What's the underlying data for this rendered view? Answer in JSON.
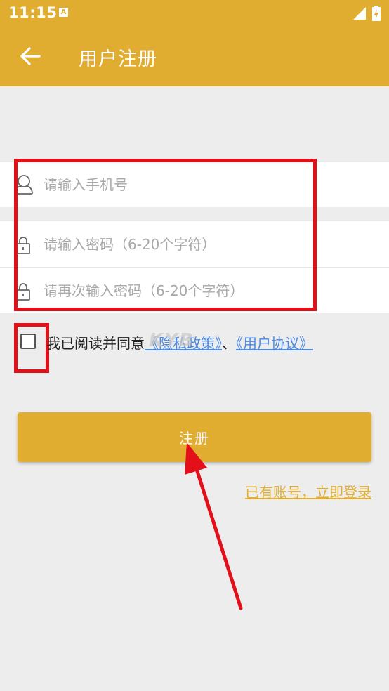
{
  "status_bar": {
    "time": "11:15",
    "notification_icon": "A"
  },
  "header": {
    "title": "用户注册",
    "back_icon": "arrow-left"
  },
  "form": {
    "phone_placeholder": "请输入手机号",
    "password_placeholder": "请输入密码（6-20个字符）",
    "confirm_password_placeholder": "请再次输入密码（6-20个字符）"
  },
  "agreement": {
    "prefix": "我已阅读并同意",
    "privacy_link": "《隐私政策》",
    "separator": "、",
    "user_agreement_link": "《用户协议》"
  },
  "watermark": "KYB",
  "register_button": "注册",
  "login_link": "已有账号，立即登录",
  "colors": {
    "brand": "#e0ad31",
    "annotation_red": "#e3101a",
    "link_blue": "#4a8ae6",
    "background": "#ededed"
  }
}
